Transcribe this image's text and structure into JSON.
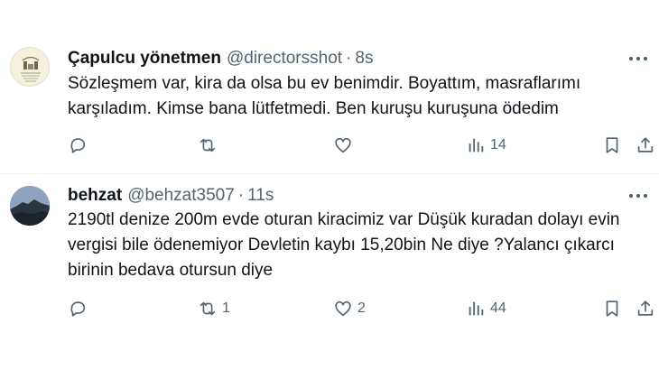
{
  "tweets": [
    {
      "display_name": "Çapulcu yönetmen",
      "handle": "@directorsshot",
      "separator": "·",
      "time": "8s",
      "text": "Sözleşmem var, kira da olsa bu ev benimdir. Boyattım, masraflarımı karşıladım. Kimse bana lütfetmedi. Ben kuruşu kuruşuna ödedim",
      "replies": "",
      "retweets": "",
      "likes": "",
      "views": "14"
    },
    {
      "display_name": "behzat",
      "handle": "@behzat3507",
      "separator": "·",
      "time": "11s",
      "text": "2190tl denize 200m evde oturan kiracimiz var Düşük kuradan dolayı evin vergisi bile ödenemiyor Devletin kaybı 15,20bin Ne diye ?Yalancı çıkarcı birinin bedava otursun diye",
      "replies": "",
      "retweets": "1",
      "likes": "2",
      "views": "44"
    }
  ],
  "icons": {
    "more": "more-horizontal-icon",
    "reply": "reply-icon",
    "retweet": "retweet-icon",
    "like": "heart-icon",
    "views": "views-chart-icon",
    "bookmark": "bookmark-icon",
    "share": "share-icon"
  },
  "colors": {
    "text_primary": "#0f1419",
    "text_secondary": "#536471",
    "divider": "#eff3f4",
    "background": "#ffffff"
  }
}
